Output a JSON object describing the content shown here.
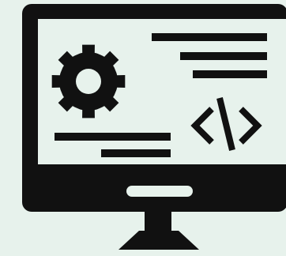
{
  "icon": {
    "name": "web-development-monitor-icon",
    "elements": [
      "monitor-icon",
      "gear-icon",
      "code-brackets-icon",
      "text-lines"
    ]
  },
  "colors": {
    "background": "#e7f2ec",
    "ink": "#111111"
  }
}
